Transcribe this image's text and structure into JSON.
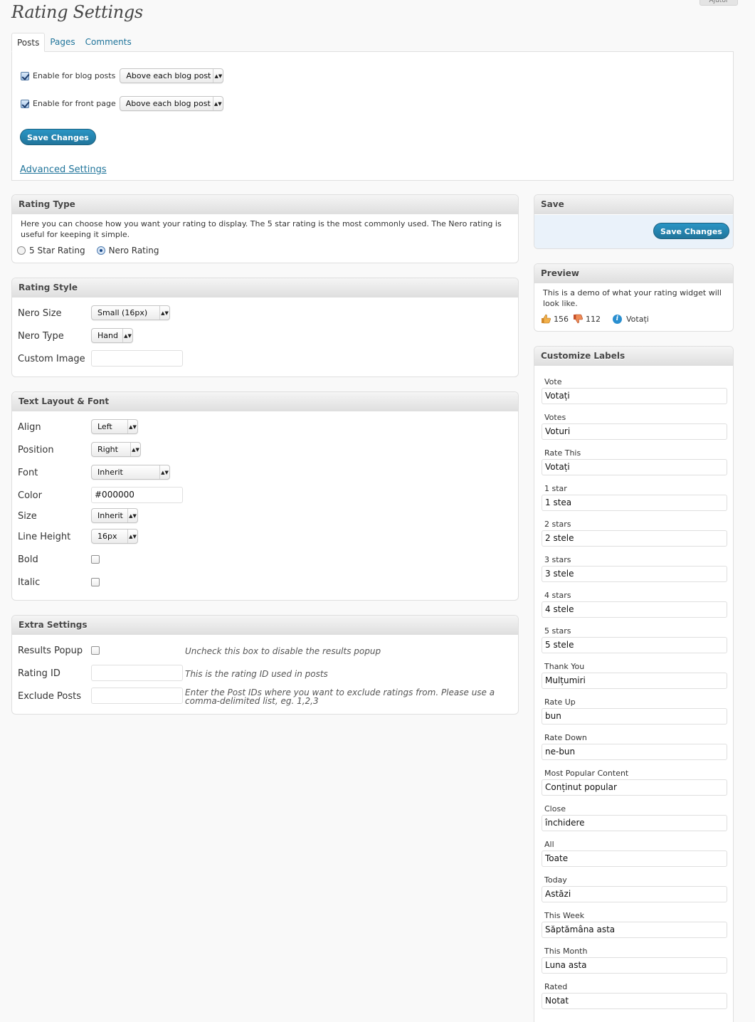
{
  "header": {
    "page_title": "Rating Settings",
    "help_tab": "Ajutor"
  },
  "tabs": [
    {
      "label": "Posts",
      "active": true
    },
    {
      "label": "Pages",
      "active": false
    },
    {
      "label": "Comments",
      "active": false
    }
  ],
  "posts_tab": {
    "enable_blog_posts": {
      "label": "Enable for blog posts",
      "checked": true,
      "select": "Above each blog post"
    },
    "enable_front_page": {
      "label": "Enable for front page",
      "checked": true,
      "select": "Above each blog post"
    },
    "save_label": "Save Changes",
    "advanced_link": "Advanced Settings"
  },
  "rating_type": {
    "title": "Rating Type",
    "description": "Here you can choose how you want your rating to display. The 5 star rating is the most commonly used. The Nero rating is useful for keeping it simple.",
    "options": [
      {
        "label": "5 Star Rating",
        "selected": false
      },
      {
        "label": "Nero Rating",
        "selected": true
      }
    ]
  },
  "rating_style": {
    "title": "Rating Style",
    "nero_size": {
      "label": "Nero Size",
      "value": "Small (16px)"
    },
    "nero_type": {
      "label": "Nero Type",
      "value": "Hand"
    },
    "custom_image": {
      "label": "Custom Image",
      "value": ""
    }
  },
  "text_layout": {
    "title": "Text Layout & Font",
    "align": {
      "label": "Align",
      "value": "Left"
    },
    "position": {
      "label": "Position",
      "value": "Right"
    },
    "font": {
      "label": "Font",
      "value": "Inherit"
    },
    "color": {
      "label": "Color",
      "value": "#000000"
    },
    "size": {
      "label": "Size",
      "value": "Inherit"
    },
    "line_height": {
      "label": "Line Height",
      "value": "16px"
    },
    "bold": {
      "label": "Bold",
      "checked": false
    },
    "italic": {
      "label": "Italic",
      "checked": false
    }
  },
  "extra_settings": {
    "title": "Extra Settings",
    "results_popup": {
      "label": "Results Popup",
      "checked": false,
      "hint": "Uncheck this box to disable the results popup"
    },
    "rating_id": {
      "label": "Rating ID",
      "value": "",
      "hint": "This is the rating ID used in posts"
    },
    "exclude_posts": {
      "label": "Exclude Posts",
      "value": "",
      "hint": "Enter the Post IDs where you want to exclude ratings from. Please use a comma-delimited list, eg. 1,2,3"
    }
  },
  "save_box": {
    "title": "Save",
    "button": "Save Changes"
  },
  "preview_box": {
    "title": "Preview",
    "description": "This is a demo of what your rating widget will look like.",
    "up_count": "156",
    "down_count": "112",
    "vote_label": "Votați"
  },
  "customize_labels": {
    "title": "Customize Labels",
    "items": [
      {
        "label": "Vote",
        "value": "Votați"
      },
      {
        "label": "Votes",
        "value": "Voturi"
      },
      {
        "label": "Rate This",
        "value": "Votați"
      },
      {
        "label": "1 star",
        "value": "1 stea"
      },
      {
        "label": "2 stars",
        "value": "2 stele"
      },
      {
        "label": "3 stars",
        "value": "3 stele"
      },
      {
        "label": "4 stars",
        "value": "4 stele"
      },
      {
        "label": "5 stars",
        "value": "5 stele"
      },
      {
        "label": "Thank You",
        "value": "Mulțumiri"
      },
      {
        "label": "Rate Up",
        "value": "bun"
      },
      {
        "label": "Rate Down",
        "value": "ne-bun"
      },
      {
        "label": "Most Popular Content",
        "value": "Conținut popular"
      },
      {
        "label": "Close",
        "value": "închidere"
      },
      {
        "label": "All",
        "value": "Toate"
      },
      {
        "label": "Today",
        "value": "Astăzi"
      },
      {
        "label": "This Week",
        "value": "Săptămâna asta"
      },
      {
        "label": "This Month",
        "value": "Luna asta"
      },
      {
        "label": "Rated",
        "value": "Notat"
      }
    ]
  },
  "colors": {
    "accent": "#21759b",
    "button": "#21759b",
    "save_box_bg": "#eaf2fa"
  }
}
